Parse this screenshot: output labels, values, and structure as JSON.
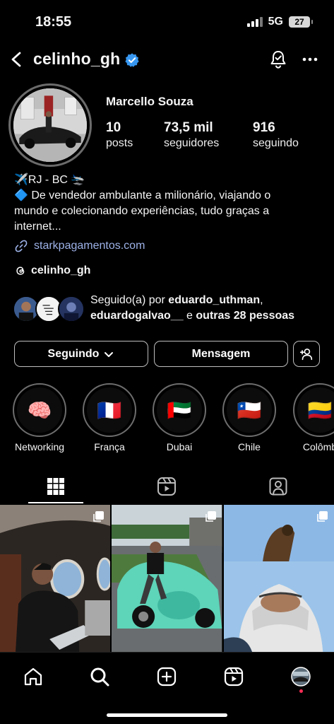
{
  "status_bar": {
    "time": "18:55",
    "network": "5G",
    "battery": "27"
  },
  "header": {
    "username": "celinho_gh"
  },
  "profile": {
    "display_name": "Marcello Souza",
    "stats": [
      {
        "value": "10",
        "label": "posts"
      },
      {
        "value": "73,5 mil",
        "label": "seguidores"
      },
      {
        "value": "916",
        "label": "seguindo"
      }
    ],
    "bio_lines": [
      "✈️RJ - BC 🛬",
      "🔷 De vendedor ambulante a milionário, viajando o",
      "mundo e colecionando experiências, tudo graças a",
      "internet..."
    ],
    "link": "starkpagamentos.com",
    "threads_handle": "celinho_gh",
    "followed_by": {
      "prefix": "Seguido(a) por ",
      "user1": "eduardo_uthman",
      "sep": ",",
      "user2": "eduardogalvao__",
      "middle": " e ",
      "others": "outras 28 pessoas"
    }
  },
  "buttons": {
    "following": "Seguindo",
    "message": "Mensagem"
  },
  "highlights": [
    {
      "emoji": "🧠",
      "label": "Networking"
    },
    {
      "emoji": "🇫🇷",
      "label": "França"
    },
    {
      "emoji": "🇦🇪",
      "label": "Dubai"
    },
    {
      "emoji": "🇨🇱",
      "label": "Chile"
    },
    {
      "emoji": "🇨🇴",
      "label": "Colômb"
    }
  ],
  "colors": {
    "accent_link": "#9db2e8",
    "verified": "#3797f0",
    "background": "#000000"
  }
}
